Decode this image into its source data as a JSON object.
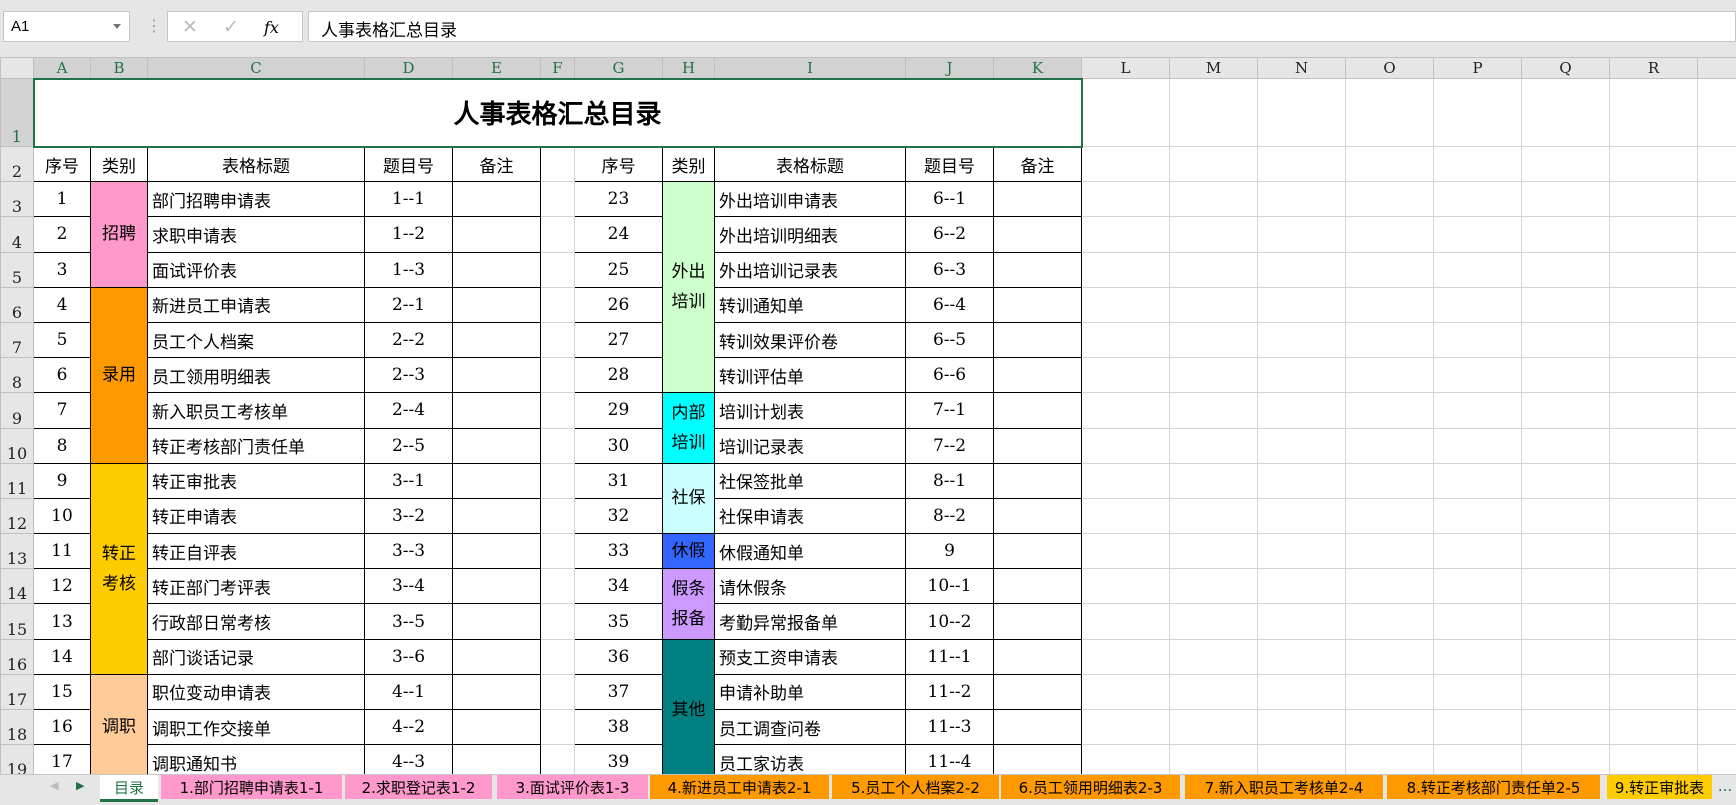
{
  "formula_bar": {
    "cell_ref": "A1",
    "cancel_icon": "✕",
    "enter_icon": "✓",
    "fx_label": "fx",
    "value": "人事表格汇总目录"
  },
  "columns": [
    "A",
    "B",
    "C",
    "D",
    "E",
    "F",
    "G",
    "H",
    "I",
    "J",
    "K",
    "L",
    "M",
    "N",
    "O",
    "P",
    "Q",
    "R",
    ""
  ],
  "title": "人事表格汇总目录",
  "headers": {
    "no": "序号",
    "category": "类别",
    "form_title": "表格标题",
    "code": "题目号",
    "note": "备注"
  },
  "left": {
    "items": [
      {
        "no": "1",
        "title": "部门招聘申请表",
        "code": "1--1"
      },
      {
        "no": "2",
        "title": "求职申请表",
        "code": "1--2"
      },
      {
        "no": "3",
        "title": "面试评价表",
        "code": "1--3"
      },
      {
        "no": "4",
        "title": "新进员工申请表",
        "code": "2--1"
      },
      {
        "no": "5",
        "title": "员工个人档案",
        "code": "2--2"
      },
      {
        "no": "6",
        "title": "员工领用明细表",
        "code": "2--3"
      },
      {
        "no": "7",
        "title": "新入职员工考核单",
        "code": "2--4"
      },
      {
        "no": "8",
        "title": "转正考核部门责任单",
        "code": "2--5"
      },
      {
        "no": "9",
        "title": "转正审批表",
        "code": "3--1"
      },
      {
        "no": "10",
        "title": "转正申请表",
        "code": "3--2"
      },
      {
        "no": "11",
        "title": "转正自评表",
        "code": "3--3"
      },
      {
        "no": "12",
        "title": "转正部门考评表",
        "code": "3--4"
      },
      {
        "no": "13",
        "title": "行政部日常考核",
        "code": "3--5"
      },
      {
        "no": "14",
        "title": "部门谈话记录",
        "code": "3--6"
      },
      {
        "no": "15",
        "title": "职位变动申请表",
        "code": "4--1"
      },
      {
        "no": "16",
        "title": "调职工作交接单",
        "code": "4--2"
      },
      {
        "no": "17",
        "title": "调职通知书",
        "code": "4--3"
      }
    ],
    "categories": [
      {
        "label": "招聘",
        "span": 3,
        "color": "#FF99CC"
      },
      {
        "label": "录用",
        "span": 5,
        "color": "#FF9900"
      },
      {
        "label": "转正\n考核",
        "span": 6,
        "color": "#FFCC00"
      },
      {
        "label": "调职",
        "span": 3,
        "color": "#FFCC99"
      }
    ]
  },
  "right": {
    "items": [
      {
        "no": "23",
        "title": "外出培训申请表",
        "code": "6--1"
      },
      {
        "no": "24",
        "title": "外出培训明细表",
        "code": "6--2"
      },
      {
        "no": "25",
        "title": "外出培训记录表",
        "code": "6--3"
      },
      {
        "no": "26",
        "title": "转训通知单",
        "code": "6--4"
      },
      {
        "no": "27",
        "title": "转训效果评价卷",
        "code": "6--5"
      },
      {
        "no": "28",
        "title": "转训评估单",
        "code": "6--6"
      },
      {
        "no": "29",
        "title": "培训计划表",
        "code": "7--1"
      },
      {
        "no": "30",
        "title": "培训记录表",
        "code": "7--2"
      },
      {
        "no": "31",
        "title": "社保签批单",
        "code": "8--1"
      },
      {
        "no": "32",
        "title": "社保申请表",
        "code": "8--2"
      },
      {
        "no": "33",
        "title": "休假通知单",
        "code": "9"
      },
      {
        "no": "34",
        "title": "请休假条",
        "code": "10--1"
      },
      {
        "no": "35",
        "title": "考勤异常报备单",
        "code": "10--2"
      },
      {
        "no": "36",
        "title": "预支工资申请表",
        "code": "11--1"
      },
      {
        "no": "37",
        "title": "申请补助单",
        "code": "11--2"
      },
      {
        "no": "38",
        "title": "员工调查问卷",
        "code": "11--3"
      },
      {
        "no": "39",
        "title": "员工家访表",
        "code": "11--4"
      }
    ],
    "categories": [
      {
        "label": "外出\n培训",
        "span": 6,
        "color": "#CCFFCC"
      },
      {
        "label": "内部\n培训",
        "span": 2,
        "color": "#00FFFF"
      },
      {
        "label": "社保",
        "span": 2,
        "color": "#CCFFFF"
      },
      {
        "label": "休假",
        "span": 1,
        "color": "#3366FF"
      },
      {
        "label": "假条\n报备",
        "span": 2,
        "color": "#CC99FF"
      },
      {
        "label": "其他",
        "span": 4,
        "color": "#008080"
      }
    ]
  },
  "sheet_tabs": [
    {
      "label": "目录",
      "color": "#FFFFFF",
      "active": true
    },
    {
      "label": "1.部门招聘申请表1-1",
      "color": "#FF99CC"
    },
    {
      "label": "2.求职登记表1-2",
      "color": "#FF99CC"
    },
    {
      "label": "3.面试评价表1-3",
      "color": "#FF99CC"
    },
    {
      "label": "4.新进员工申请表2-1",
      "color": "#FF9900"
    },
    {
      "label": "5.员工个人档案2-2",
      "color": "#FF9900"
    },
    {
      "label": "6.员工领用明细表2-3",
      "color": "#FF9900"
    },
    {
      "label": "7.新入职员工考核单2-4",
      "color": "#FF9900"
    },
    {
      "label": "8.转正考核部门责任单2-5",
      "color": "#FF9900"
    },
    {
      "label": "9.转正审批表",
      "color": "#FFCC00"
    }
  ],
  "more_tabs": "...",
  "nav": {
    "prev": "◀",
    "next": "▶"
  }
}
